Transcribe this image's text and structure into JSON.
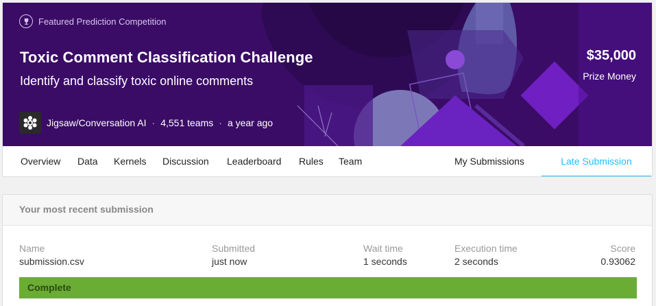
{
  "competition": {
    "badge": "Featured Prediction Competition",
    "title": "Toxic Comment Classification Challenge",
    "subtitle": "Identify and classify toxic online comments",
    "prize_value": "$35,000",
    "prize_label": "Prize Money",
    "host": "Jigsaw/Conversation AI",
    "separator": "·",
    "teams": "4,551 teams",
    "time_ago": "a year ago",
    "icons": {
      "badge": "trophy-icon",
      "host": "host-logo"
    }
  },
  "tabs": [
    {
      "label": "Overview"
    },
    {
      "label": "Data"
    },
    {
      "label": "Kernels"
    },
    {
      "label": "Discussion"
    },
    {
      "label": "Leaderboard"
    },
    {
      "label": "Rules"
    },
    {
      "label": "Team"
    },
    {
      "label": "My Submissions"
    },
    {
      "label": "Late Submission",
      "active": true
    }
  ],
  "submission": {
    "heading": "Your most recent submission",
    "columns": {
      "name": {
        "header": "Name",
        "value": "submission.csv"
      },
      "submitted": {
        "header": "Submitted",
        "value": "just now"
      },
      "wait": {
        "header": "Wait time",
        "value": "1 seconds"
      },
      "execution": {
        "header": "Execution time",
        "value": "2 seconds"
      },
      "score": {
        "header": "Score",
        "value": "0.93062"
      }
    },
    "status": "Complete",
    "status_color": "#6aac34"
  },
  "colors": {
    "banner": "#3d0d6b",
    "accent": "#20beff"
  }
}
